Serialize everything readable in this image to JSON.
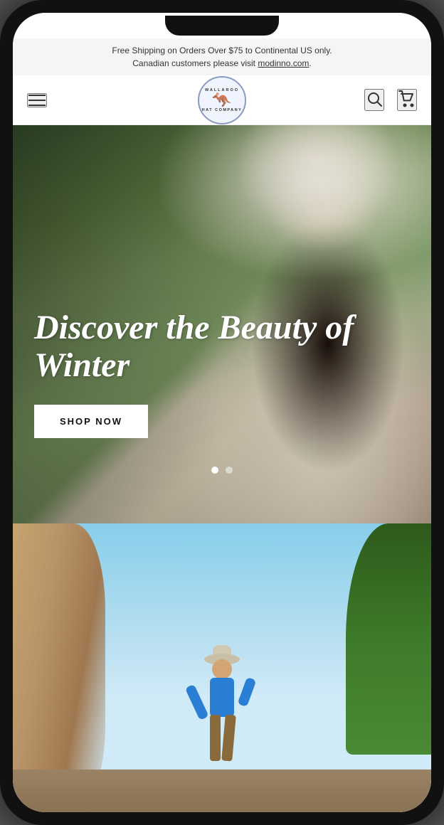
{
  "phone": {
    "announcement": {
      "line1": "Free Shipping on Orders Over $75 to Continental US only.",
      "line2": "Canadian customers please visit ",
      "link_text": "modinno.com",
      "link_url": "modinno.com"
    },
    "header": {
      "menu_label": "Menu",
      "logo_alt": "Wallaroo Hat Company",
      "logo_text_top": "WALLAROO",
      "logo_text_bottom": "HAT COMPANY",
      "search_label": "Search",
      "cart_label": "Cart"
    },
    "hero": {
      "title": "Discover the Beauty of Winter",
      "cta_label": "SHOP NOW",
      "slide_count": 2,
      "active_slide": 0
    },
    "second_section": {
      "alt": "Man wearing hat outdoors in nature"
    }
  }
}
